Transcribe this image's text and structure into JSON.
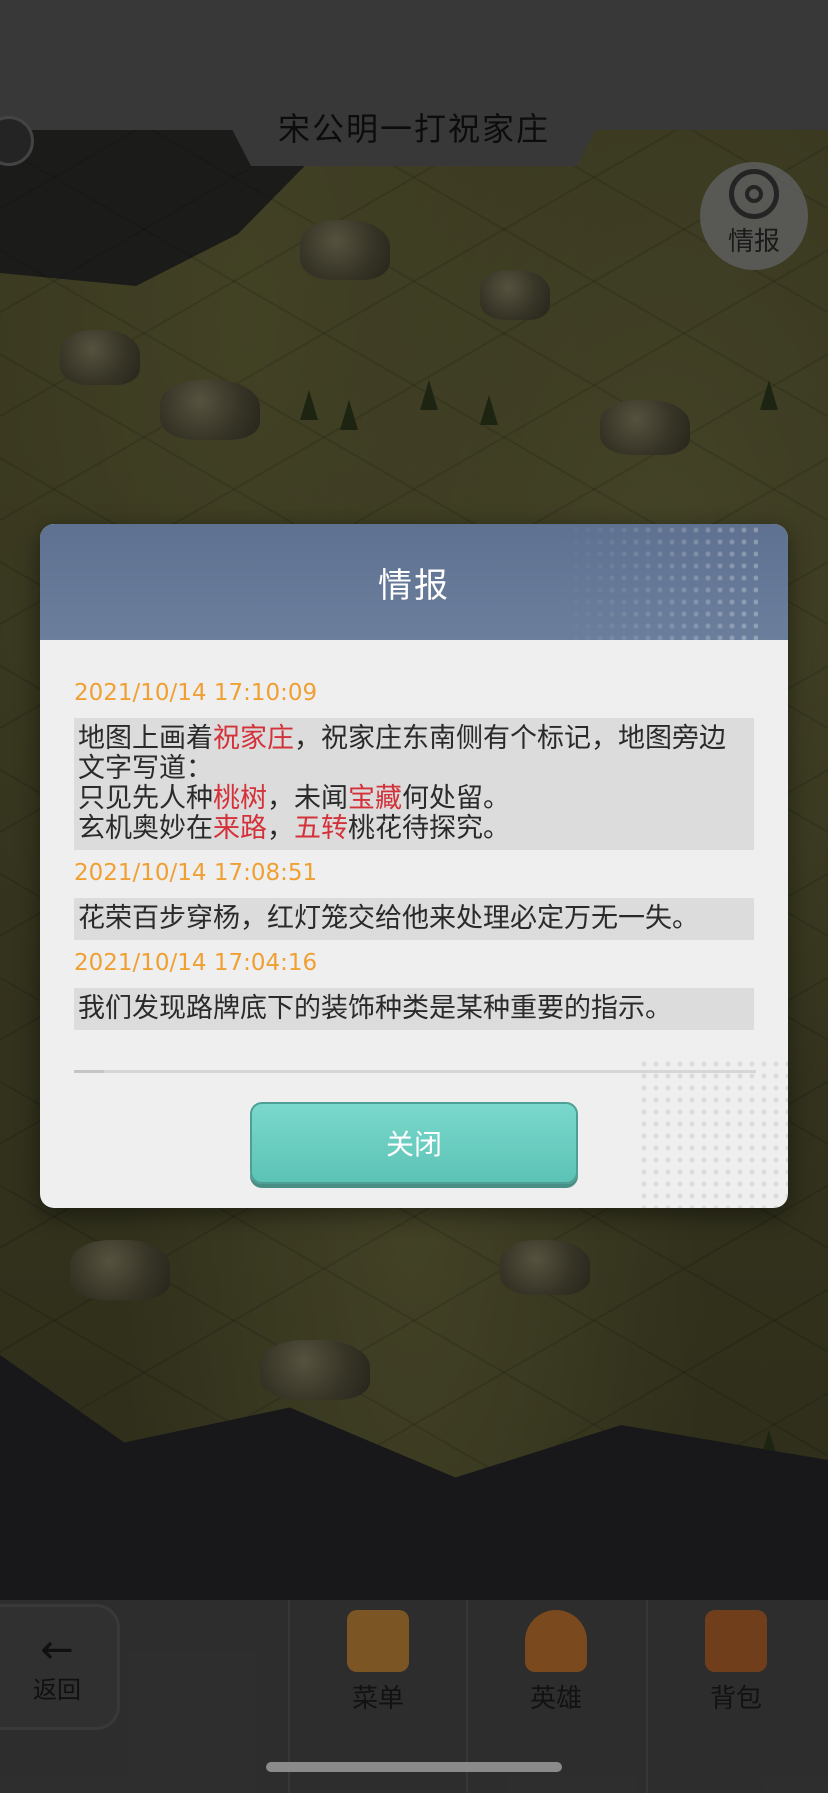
{
  "level": {
    "title": "宋公明一打祝家庄"
  },
  "intel_button": {
    "label": "情报",
    "icon": "target-icon"
  },
  "dialog": {
    "title": "情报",
    "entries": [
      {
        "time": "2021/10/14  17:10:09",
        "lines": [
          [
            {
              "t": "地图上画着"
            },
            {
              "t": "祝家庄",
              "hl": true
            },
            {
              "t": "，祝家庄东南侧有个标记，地图旁边文字写道："
            }
          ],
          [
            {
              "t": "只见先人种"
            },
            {
              "t": "桃树",
              "hl": true
            },
            {
              "t": "，未闻"
            },
            {
              "t": "宝藏",
              "hl": true
            },
            {
              "t": "何处留。"
            }
          ],
          [
            {
              "t": "玄机奥妙在"
            },
            {
              "t": "来路",
              "hl": true
            },
            {
              "t": "，"
            },
            {
              "t": "五转",
              "hl": true
            },
            {
              "t": "桃花待探究。"
            }
          ]
        ]
      },
      {
        "time": "2021/10/14  17:08:51",
        "lines": [
          [
            {
              "t": "花荣百步穿杨，红灯笼交给他来处理必定万无一失。"
            }
          ]
        ]
      },
      {
        "time": "2021/10/14  17:04:16",
        "lines": [
          [
            {
              "t": "我们发现路牌底下的装饰种类是某种重要的指示。"
            }
          ]
        ]
      }
    ],
    "close_label": "关闭",
    "highlight_color": "#d3323a",
    "time_color": "#f0a032"
  },
  "bottom_nav": {
    "back_label": "返回",
    "items": [
      {
        "label": "菜单",
        "icon": "scroll-menu-icon",
        "color": "#c98a3b"
      },
      {
        "label": "英雄",
        "icon": "hero-helmet-icon",
        "color": "#c5772f"
      },
      {
        "label": "背包",
        "icon": "backpack-icon",
        "color": "#b5652c"
      }
    ]
  }
}
